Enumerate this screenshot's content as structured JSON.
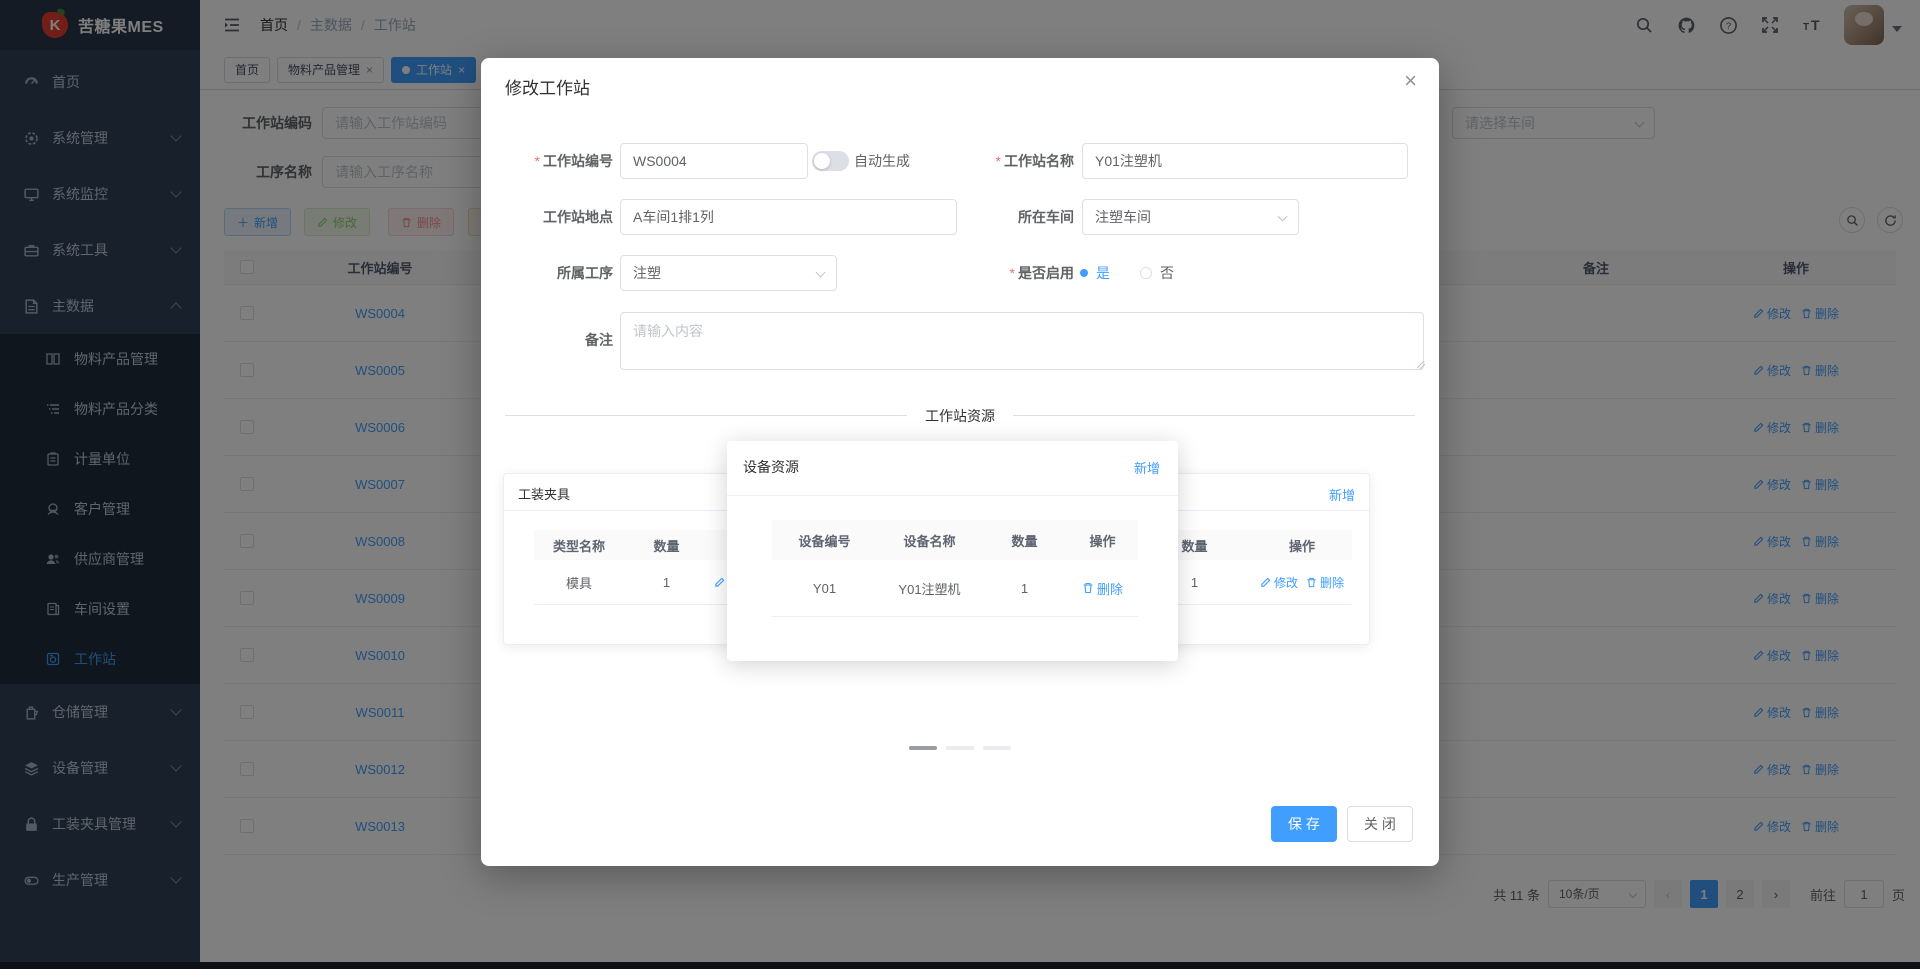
{
  "app": {
    "logo_text": "苦糖果MES"
  },
  "navbar": {
    "breadcrumb": [
      "首页",
      "主数据",
      "工作站"
    ]
  },
  "tabs": {
    "home": "首页",
    "materials": "物料产品管理",
    "workstation": "工作站"
  },
  "sidebar": {
    "items": [
      {
        "label": "首页"
      },
      {
        "label": "系统管理"
      },
      {
        "label": "系统监控"
      },
      {
        "label": "系统工具"
      },
      {
        "label": "主数据"
      },
      {
        "label": "物料产品管理"
      },
      {
        "label": "物料产品分类"
      },
      {
        "label": "计量单位"
      },
      {
        "label": "客户管理"
      },
      {
        "label": "供应商管理"
      },
      {
        "label": "车间设置"
      },
      {
        "label": "工作站"
      },
      {
        "label": "仓储管理"
      },
      {
        "label": "设备管理"
      },
      {
        "label": "工装夹具管理"
      },
      {
        "label": "生产管理"
      }
    ]
  },
  "search": {
    "code_label": "工作站编码",
    "code_placeholder": "请输入工作站编码",
    "process_label": "工序名称",
    "process_placeholder": "请输入工序名称",
    "workshop_placeholder": "请选择车间"
  },
  "toolbar": {
    "add": "新增",
    "edit": "修改",
    "delete": "删除"
  },
  "table": {
    "header_code": "工作站编号",
    "header_remark": "备注",
    "header_action": "操作",
    "edit_label": "修改",
    "delete_label": "删除",
    "rows": [
      {
        "code": "WS0004"
      },
      {
        "code": "WS0005"
      },
      {
        "code": "WS0006"
      },
      {
        "code": "WS0007"
      },
      {
        "code": "WS0008"
      },
      {
        "code": "WS0009"
      },
      {
        "code": "WS0010"
      },
      {
        "code": "WS0011"
      },
      {
        "code": "WS0012"
      },
      {
        "code": "WS0013"
      }
    ]
  },
  "pagination": {
    "total": "共 11 条",
    "page_size": "10条/页",
    "page1": "1",
    "page2": "2",
    "goto": "前往",
    "goto_value": "1",
    "unit": "页"
  },
  "modal": {
    "title": "修改工作站",
    "code_label": "工作站编号",
    "code_value": "WS0004",
    "auto_label": "自动生成",
    "name_label": "工作站名称",
    "name_value": "Y01注塑机",
    "location_label": "工作站地点",
    "location_value": "A车间1排1列",
    "workshop_label": "所在车间",
    "workshop_value": "注塑车间",
    "process_label": "所属工序",
    "process_value": "注塑",
    "enable_label": "是否启用",
    "yes": "是",
    "no": "否",
    "remark_label": "备注",
    "remark_placeholder": "请输入内容",
    "divider": "工作站资源",
    "fixture": {
      "title": "工装夹具",
      "h_type": "类型名称",
      "h_qty": "数量",
      "row_type": "模具",
      "row_qty": "1",
      "edit": "修改"
    },
    "device": {
      "title": "设备资源",
      "add": "新增",
      "h_code": "设备编号",
      "h_name": "设备名称",
      "h_qty": "数量",
      "h_action": "操作",
      "row_code": "Y01",
      "row_name": "Y01注塑机",
      "row_qty": "1",
      "delete": "删除"
    },
    "extra": {
      "add": "新增",
      "h_qty": "数量",
      "h_action": "操作",
      "row_qty": "1",
      "edit": "修改",
      "delete": "删除"
    },
    "save": "保 存",
    "close": "关 闭"
  },
  "colors": {
    "primary": "#409EFF",
    "success": "#67C23A",
    "danger": "#F56C6C",
    "warning": "#E6A23C",
    "sidebar_bg": "#304156",
    "submenu_bg": "#1F2D3D"
  }
}
